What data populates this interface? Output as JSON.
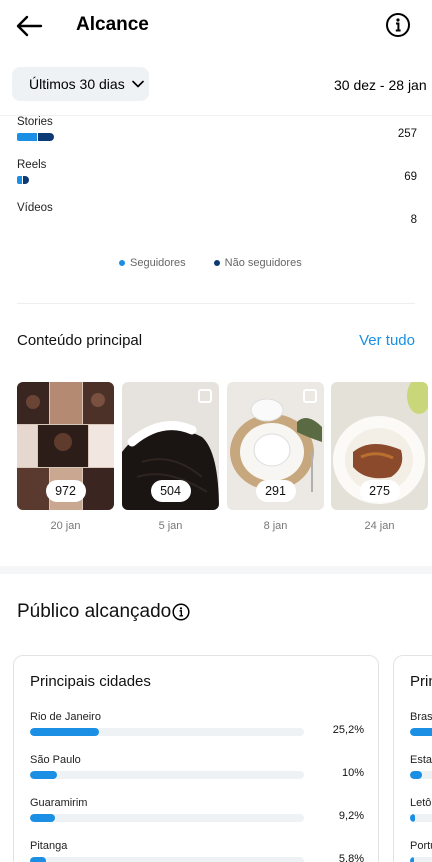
{
  "header": {
    "title": "Alcance"
  },
  "period": {
    "label": "Últimos 30 dias",
    "range": "30 dez - 28 jan"
  },
  "content_types": [
    {
      "label": "Stories",
      "value": "257",
      "followers_fraction": 0.55,
      "total_fraction": 0.09
    },
    {
      "label": "Reels",
      "value": "69",
      "followers_fraction": 0.45,
      "total_fraction": 0.028
    },
    {
      "label": "Vídeos",
      "value": "8",
      "followers_fraction": 0,
      "total_fraction": 0
    }
  ],
  "legend": {
    "followers": "Seguidores",
    "non_followers": "Não seguidores"
  },
  "colors": {
    "followers": "#1a8fe3",
    "non_followers": "#0c3a75",
    "accent": "#1a8fe3"
  },
  "top_content": {
    "title": "Conteúdo principal",
    "see_all": "Ver tudo",
    "items": [
      {
        "value": "972",
        "date": "20 jan"
      },
      {
        "value": "504",
        "date": "5 jan"
      },
      {
        "value": "291",
        "date": "8 jan"
      },
      {
        "value": "275",
        "date": "24 jan"
      }
    ]
  },
  "audience": {
    "title": "Público alcançado",
    "cities_card": {
      "title": "Principais cidades",
      "rows": [
        {
          "name": "Rio de Janeiro",
          "pct": "25,2%",
          "fraction": 0.252
        },
        {
          "name": "São Paulo",
          "pct": "10%",
          "fraction": 0.1
        },
        {
          "name": "Guaramirim",
          "pct": "9,2%",
          "fraction": 0.092
        },
        {
          "name": "Pitanga",
          "pct": "5,8%",
          "fraction": 0.058
        }
      ]
    },
    "countries_card": {
      "title": "Prin",
      "rows": [
        {
          "name": "Brasi"
        },
        {
          "name": "Estad"
        },
        {
          "name": "Letôn"
        },
        {
          "name": "Portu"
        }
      ]
    }
  }
}
